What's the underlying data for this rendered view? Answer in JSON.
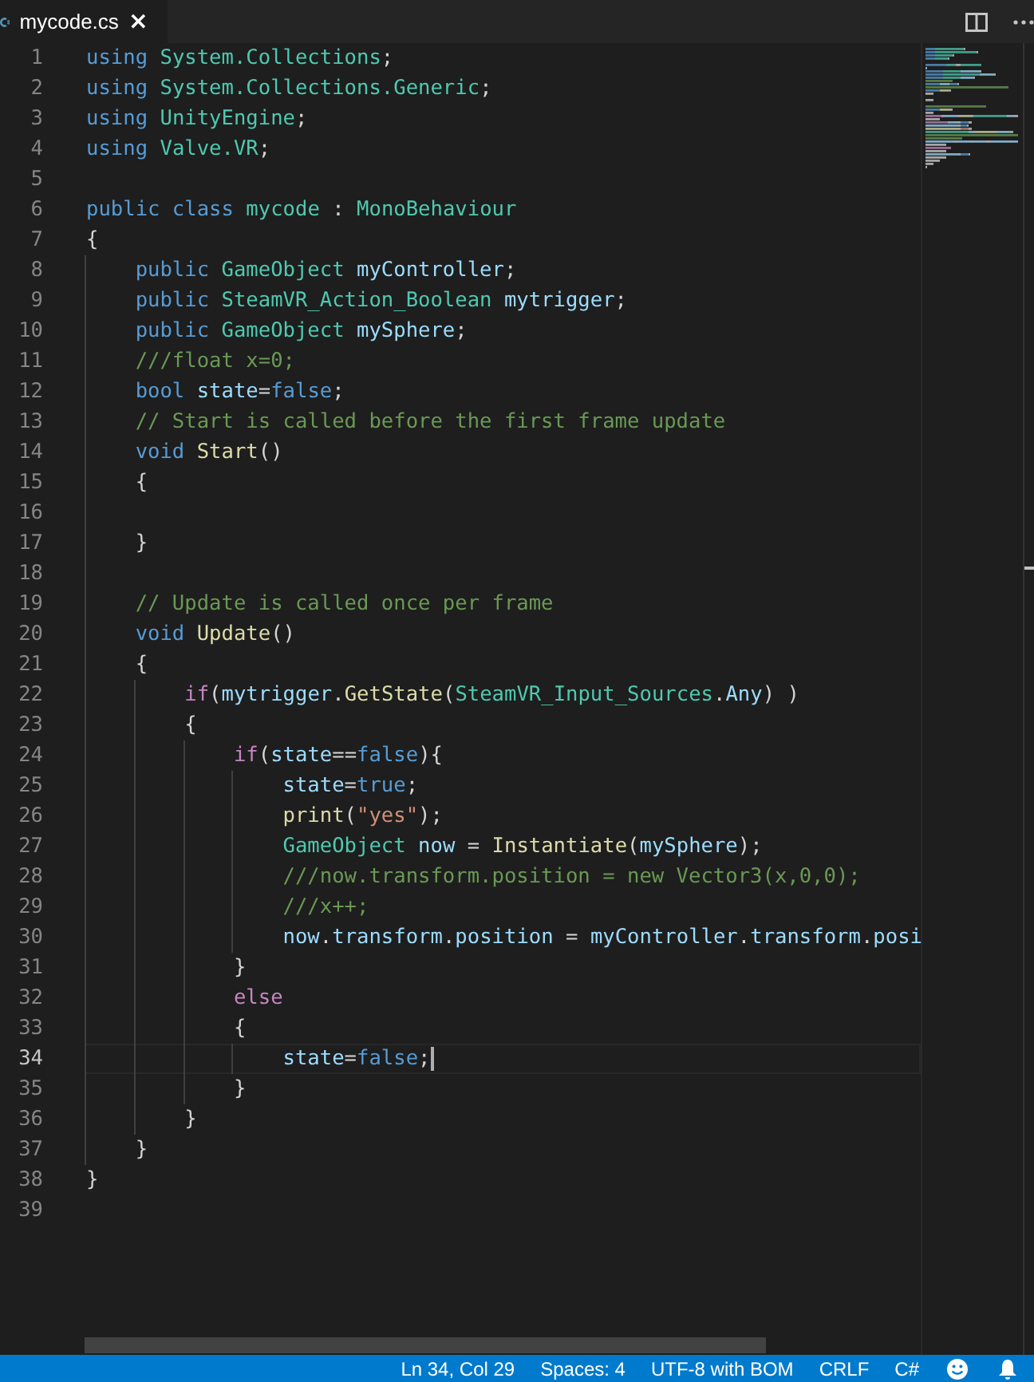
{
  "tab": {
    "title": "mycode.cs",
    "close": "×",
    "selected": true
  },
  "lines": [
    {
      "number": "1",
      "selected": false,
      "tokens": [
        {
          "kind": "keyword",
          "text": "using "
        },
        {
          "kind": "type",
          "text": "System.Collections"
        },
        {
          "kind": "plain",
          "text": ";"
        }
      ]
    },
    {
      "number": "2",
      "selected": false,
      "tokens": [
        {
          "kind": "keyword",
          "text": "using "
        },
        {
          "kind": "type",
          "text": "System.Collections.Generic"
        },
        {
          "kind": "plain",
          "text": ";"
        }
      ]
    },
    {
      "number": "3",
      "selected": false,
      "tokens": [
        {
          "kind": "keyword",
          "text": "using "
        },
        {
          "kind": "type",
          "text": "UnityEngine"
        },
        {
          "kind": "plain",
          "text": ";"
        }
      ]
    },
    {
      "number": "4",
      "selected": false,
      "tokens": [
        {
          "kind": "keyword",
          "text": "using "
        },
        {
          "kind": "type",
          "text": "Valve.VR"
        },
        {
          "kind": "plain",
          "text": ";"
        }
      ]
    },
    {
      "number": "5",
      "selected": false
    },
    {
      "number": "6",
      "selected": false,
      "tokens": [
        {
          "kind": "keyword",
          "text": "public class "
        },
        {
          "kind": "type",
          "text": "mycode"
        },
        {
          "kind": "plain",
          "text": " : "
        },
        {
          "kind": "type",
          "text": "MonoBehaviour"
        }
      ]
    },
    {
      "number": "7",
      "selected": false,
      "tokens": [
        {
          "kind": "plain",
          "text": "{"
        }
      ]
    },
    {
      "number": "8",
      "selected": false,
      "tokens": [
        {
          "kind": "keyword",
          "text": "    public "
        },
        {
          "kind": "type",
          "text": "GameObject "
        },
        {
          "kind": "variable",
          "text": "myController"
        },
        {
          "kind": "plain",
          "text": ";"
        }
      ]
    },
    {
      "number": "9",
      "selected": false,
      "tokens": [
        {
          "kind": "keyword",
          "text": "    public "
        },
        {
          "kind": "type",
          "text": "SteamVR_Action_Boolean "
        },
        {
          "kind": "variable",
          "text": "mytrigger"
        },
        {
          "kind": "plain",
          "text": ";"
        }
      ]
    },
    {
      "number": "10",
      "selected": false,
      "tokens": [
        {
          "kind": "keyword",
          "text": "    public "
        },
        {
          "kind": "type",
          "text": "GameObject "
        },
        {
          "kind": "variable",
          "text": "mySphere"
        },
        {
          "kind": "plain",
          "text": ";"
        }
      ]
    },
    {
      "number": "11",
      "selected": false,
      "tokens": [
        {
          "kind": "comment",
          "text": "    ///float x=0;"
        }
      ]
    },
    {
      "number": "12",
      "selected": false,
      "tokens": [
        {
          "kind": "keyword",
          "text": "    bool "
        },
        {
          "kind": "variable",
          "text": "state"
        },
        {
          "kind": "plain",
          "text": "="
        },
        {
          "kind": "keyword",
          "text": "false"
        },
        {
          "kind": "plain",
          "text": ";"
        }
      ]
    },
    {
      "number": "13",
      "selected": false,
      "tokens": [
        {
          "kind": "comment",
          "text": "    // Start is called before the first frame update"
        }
      ]
    },
    {
      "number": "14",
      "selected": false,
      "tokens": [
        {
          "kind": "keyword",
          "text": "    void "
        },
        {
          "kind": "function",
          "text": "Start"
        },
        {
          "kind": "plain",
          "text": "()"
        }
      ]
    },
    {
      "number": "15",
      "selected": false,
      "tokens": [
        {
          "kind": "plain",
          "text": "    {"
        }
      ]
    },
    {
      "number": "16",
      "selected": false
    },
    {
      "number": "17",
      "selected": false,
      "tokens": [
        {
          "kind": "plain",
          "text": "    }"
        }
      ]
    },
    {
      "number": "18",
      "selected": false
    },
    {
      "number": "19",
      "selected": false,
      "tokens": [
        {
          "kind": "comment",
          "text": "    // Update is called once per frame"
        }
      ]
    },
    {
      "number": "20",
      "selected": false,
      "tokens": [
        {
          "kind": "keyword",
          "text": "    void "
        },
        {
          "kind": "function",
          "text": "Update"
        },
        {
          "kind": "plain",
          "text": "()"
        }
      ]
    },
    {
      "number": "21",
      "selected": false,
      "tokens": [
        {
          "kind": "plain",
          "text": "    {"
        }
      ]
    },
    {
      "number": "22",
      "selected": false,
      "tokens": [
        {
          "kind": "control",
          "text": "        if"
        },
        {
          "kind": "plain",
          "text": "("
        },
        {
          "kind": "variable",
          "text": "mytrigger"
        },
        {
          "kind": "plain",
          "text": "."
        },
        {
          "kind": "function",
          "text": "GetState"
        },
        {
          "kind": "plain",
          "text": "("
        },
        {
          "kind": "type",
          "text": "SteamVR_Input_Sources"
        },
        {
          "kind": "plain",
          "text": "."
        },
        {
          "kind": "variable",
          "text": "Any"
        },
        {
          "kind": "plain",
          "text": ") )"
        }
      ]
    },
    {
      "number": "23",
      "selected": false,
      "tokens": [
        {
          "kind": "plain",
          "text": "        {"
        }
      ]
    },
    {
      "number": "24",
      "selected": false,
      "tokens": [
        {
          "kind": "control",
          "text": "            if"
        },
        {
          "kind": "plain",
          "text": "("
        },
        {
          "kind": "variable",
          "text": "state"
        },
        {
          "kind": "plain",
          "text": "=="
        },
        {
          "kind": "keyword",
          "text": "false"
        },
        {
          "kind": "plain",
          "text": "){"
        }
      ]
    },
    {
      "number": "25",
      "selected": false,
      "tokens": [
        {
          "kind": "variable",
          "text": "                state"
        },
        {
          "kind": "plain",
          "text": "="
        },
        {
          "kind": "keyword",
          "text": "true"
        },
        {
          "kind": "plain",
          "text": ";"
        }
      ]
    },
    {
      "number": "26",
      "selected": false,
      "tokens": [
        {
          "kind": "function",
          "text": "                print"
        },
        {
          "kind": "plain",
          "text": "("
        },
        {
          "kind": "string",
          "text": "\"yes\""
        },
        {
          "kind": "plain",
          "text": ");"
        }
      ]
    },
    {
      "number": "27",
      "selected": false,
      "tokens": [
        {
          "kind": "type",
          "text": "                GameObject "
        },
        {
          "kind": "variable",
          "text": "now"
        },
        {
          "kind": "plain",
          "text": " = "
        },
        {
          "kind": "function",
          "text": "Instantiate"
        },
        {
          "kind": "plain",
          "text": "("
        },
        {
          "kind": "variable",
          "text": "mySphere"
        },
        {
          "kind": "plain",
          "text": ");"
        }
      ]
    },
    {
      "number": "28",
      "selected": false,
      "tokens": [
        {
          "kind": "comment",
          "text": "                ///now.transform.position = new Vector3(x,0,0);"
        }
      ]
    },
    {
      "number": "29",
      "selected": false,
      "tokens": [
        {
          "kind": "comment",
          "text": "                ///x++;"
        }
      ]
    },
    {
      "number": "30",
      "selected": false,
      "tokens": [
        {
          "kind": "variable",
          "text": "                now"
        },
        {
          "kind": "plain",
          "text": "."
        },
        {
          "kind": "variable",
          "text": "transform"
        },
        {
          "kind": "plain",
          "text": "."
        },
        {
          "kind": "variable",
          "text": "position"
        },
        {
          "kind": "plain",
          "text": " = "
        },
        {
          "kind": "variable",
          "text": "myController"
        },
        {
          "kind": "plain",
          "text": "."
        },
        {
          "kind": "variable",
          "text": "transform"
        },
        {
          "kind": "plain",
          "text": "."
        },
        {
          "kind": "variable",
          "text": "posi"
        }
      ]
    },
    {
      "number": "31",
      "selected": false,
      "tokens": [
        {
          "kind": "plain",
          "text": "            }"
        }
      ]
    },
    {
      "number": "32",
      "selected": false,
      "tokens": [
        {
          "kind": "control",
          "text": "            else"
        }
      ]
    },
    {
      "number": "33",
      "selected": false,
      "tokens": [
        {
          "kind": "plain",
          "text": "            {"
        }
      ]
    },
    {
      "number": "34",
      "selected": true,
      "tokens": [
        {
          "kind": "variable",
          "text": "                state"
        },
        {
          "kind": "plain",
          "text": "="
        },
        {
          "kind": "keyword",
          "text": "false"
        },
        {
          "kind": "plain",
          "text": ";"
        }
      ]
    },
    {
      "number": "35",
      "selected": false,
      "tokens": [
        {
          "kind": "plain",
          "text": "            }"
        }
      ]
    },
    {
      "number": "36",
      "selected": false,
      "tokens": [
        {
          "kind": "plain",
          "text": "        }"
        }
      ]
    },
    {
      "number": "37",
      "selected": false,
      "tokens": [
        {
          "kind": "plain",
          "text": "    }"
        }
      ]
    },
    {
      "number": "38",
      "selected": false,
      "tokens": [
        {
          "kind": "plain",
          "text": "}"
        }
      ]
    },
    {
      "number": "39",
      "selected": false
    }
  ],
  "status_bar": {
    "items": [
      "Ln 34, Col 29",
      "Spaces: 4",
      "UTF-8 with BOM",
      "CRLF",
      "C#"
    ]
  }
}
